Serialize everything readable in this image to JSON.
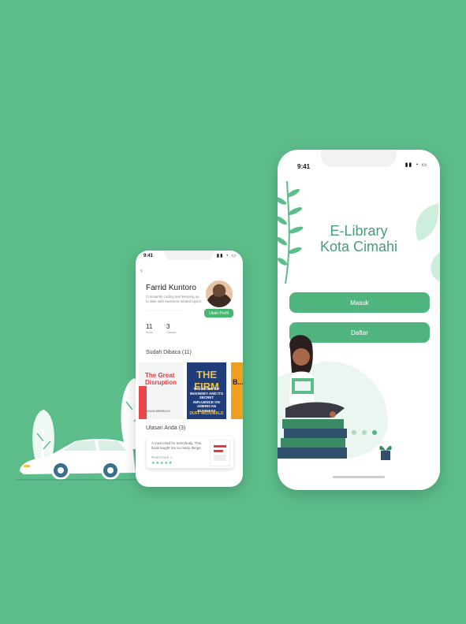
{
  "colors": {
    "background": "#5cbd8a",
    "accent": "#4fb47d",
    "accent_dark": "#4a9c78"
  },
  "profile_screen": {
    "status": {
      "time": "9:41",
      "icons": "▮▮ ◔ ▭"
    },
    "back_icon": "back-arrow-icon",
    "name": "Farrid Kuntoro",
    "bio": "Constantly coding and keeping up to date with business related topics",
    "meta": "··············· ······· ···········",
    "edit_button": "Ubah Profil",
    "stats": [
      {
        "value": "11",
        "label": "Buku"
      },
      {
        "value": "3",
        "label": "Ulasan"
      }
    ],
    "read_section": "Sudah Dibaca (11)",
    "books": [
      {
        "title": "The Great Disruption",
        "author": "ADAM WERBACH"
      },
      {
        "title": "THE FIRM",
        "subtitle": "THE STORY OF McKINSEY AND ITS SECRET INFLUENCE ON AMERICAN BUSINESS",
        "author": "DUFF McDONALD"
      },
      {
        "title": "B..."
      }
    ],
    "reviews_section": "Ulasan Anda (3)",
    "review": {
      "text": "A must read for everybody. This book taught me so many things",
      "read_more": "Read more »",
      "stars": 5,
      "stars_text": "★★★★★"
    }
  },
  "login_screen": {
    "status": {
      "time": "9:41",
      "icons": "▮▮ ◔ ▭"
    },
    "title_line1": "E-Library",
    "title_line2": "Kota Cimahi",
    "login_button": "Masuk",
    "register_button": "Daftar",
    "carousel": {
      "count": 3,
      "active": 2
    }
  }
}
